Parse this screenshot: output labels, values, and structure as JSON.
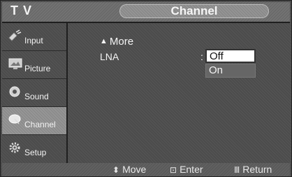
{
  "header": {
    "brand": "T V",
    "title": "Channel"
  },
  "sidebar": {
    "items": [
      {
        "label": "Input",
        "icon": "input-plug-icon"
      },
      {
        "label": "Picture",
        "icon": "picture-monitor-icon"
      },
      {
        "label": "Sound",
        "icon": "speaker-icon"
      },
      {
        "label": "Channel",
        "icon": "satellite-dish-icon",
        "active": true
      },
      {
        "label": "Setup",
        "icon": "gear-icon"
      }
    ]
  },
  "main": {
    "more_label": "More",
    "setting_label": "LNA",
    "options": [
      "Off",
      "On"
    ],
    "selected_option": "Off"
  },
  "footer": {
    "move_label": "Move",
    "enter_label": "Enter",
    "return_label": "Return"
  }
}
